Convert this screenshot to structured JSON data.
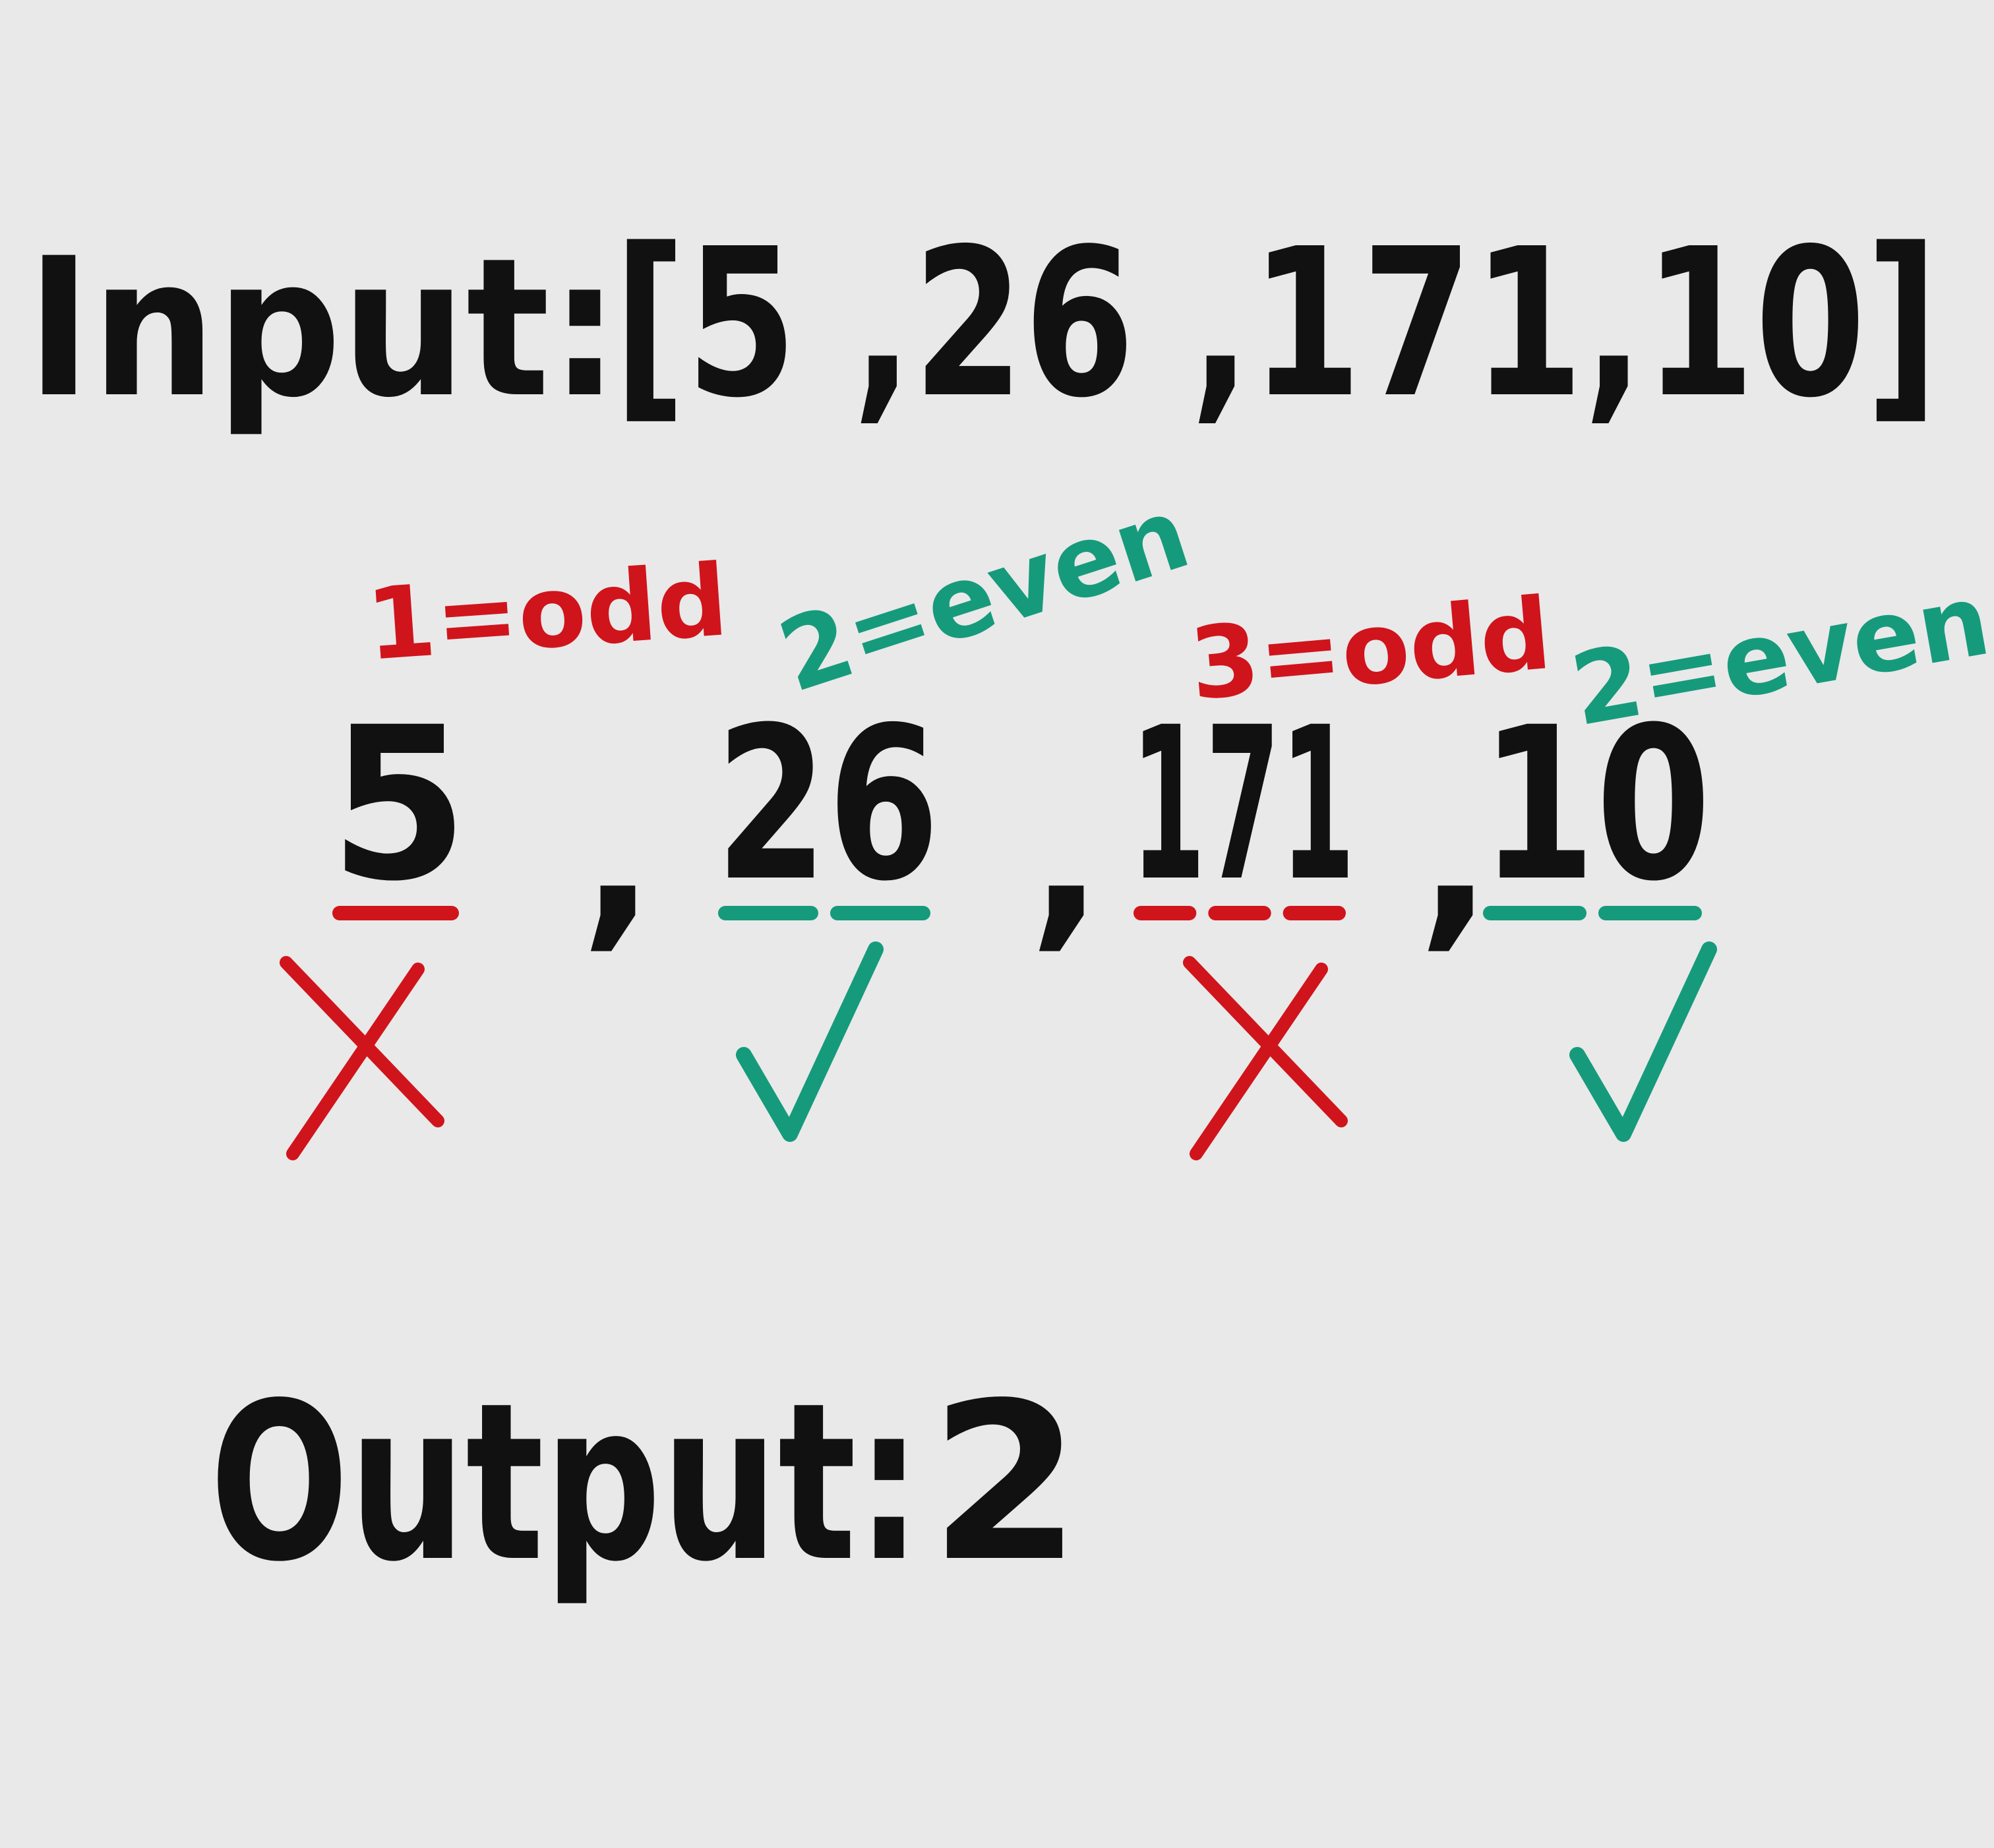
{
  "input": {
    "label": "Input:",
    "list": "[5 ,26 ,171,10]"
  },
  "items": [
    {
      "number": "5",
      "annotation": "1=odd",
      "parity": "odd",
      "mark": "x-mark",
      "digits_underlined": 1
    },
    {
      "number": "26",
      "annotation": "2=even",
      "parity": "even",
      "mark": "check-mark",
      "digits_underlined": 2
    },
    {
      "number": "171",
      "annotation": "3=odd",
      "parity": "odd",
      "mark": "x-mark",
      "digits_underlined": 3
    },
    {
      "number": "10",
      "annotation": "2=even",
      "parity": "even",
      "mark": "check-mark",
      "digits_underlined": 2
    }
  ],
  "separator": ",",
  "output": {
    "label": "Output:",
    "value": "2"
  },
  "colors": {
    "ink": "#111111",
    "odd": "#d0141c",
    "even": "#169a7c",
    "board": "#e9e9e9"
  }
}
